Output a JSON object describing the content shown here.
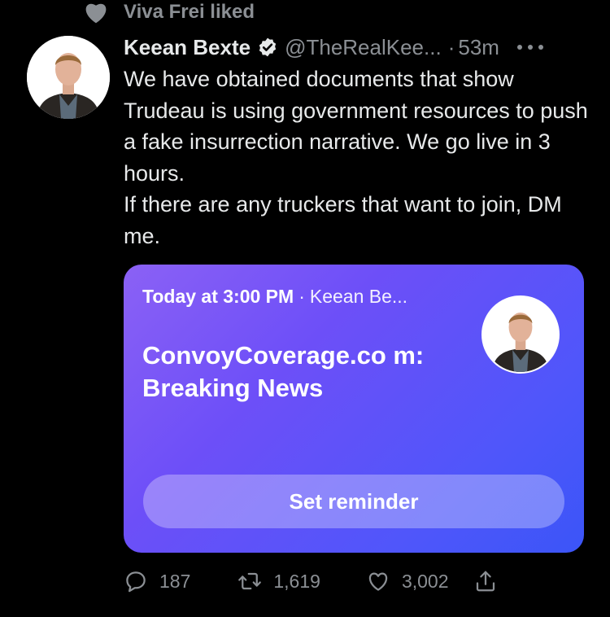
{
  "social_context": {
    "icon": "heart-icon",
    "text": "Viva Frei liked"
  },
  "author": {
    "name": "Keean Bexte",
    "handle": "@TheRealKee...",
    "separator": "·",
    "time": "53m",
    "verified": true,
    "avatar_icon": "profile-photo"
  },
  "tweet": {
    "text": "We have obtained documents that show Trudeau is using government resources to push a fake insurrection narrative. We go live in 3 hours.\nIf there are any truckers that want to join, DM me."
  },
  "card": {
    "when": "Today at 3:00 PM",
    "separator": "·",
    "host": "Keean Be...",
    "title": "ConvoyCoverage.co m: Breaking News",
    "reminder_label": "Set reminder"
  },
  "actions": {
    "reply_count": "187",
    "retweet_count": "1,619",
    "like_count": "3,002"
  },
  "colors": {
    "background": "#000000",
    "secondary_text": "#8b8f94",
    "card_gradient_start": "#8b61f5",
    "card_gradient_end": "#3b55f8"
  }
}
